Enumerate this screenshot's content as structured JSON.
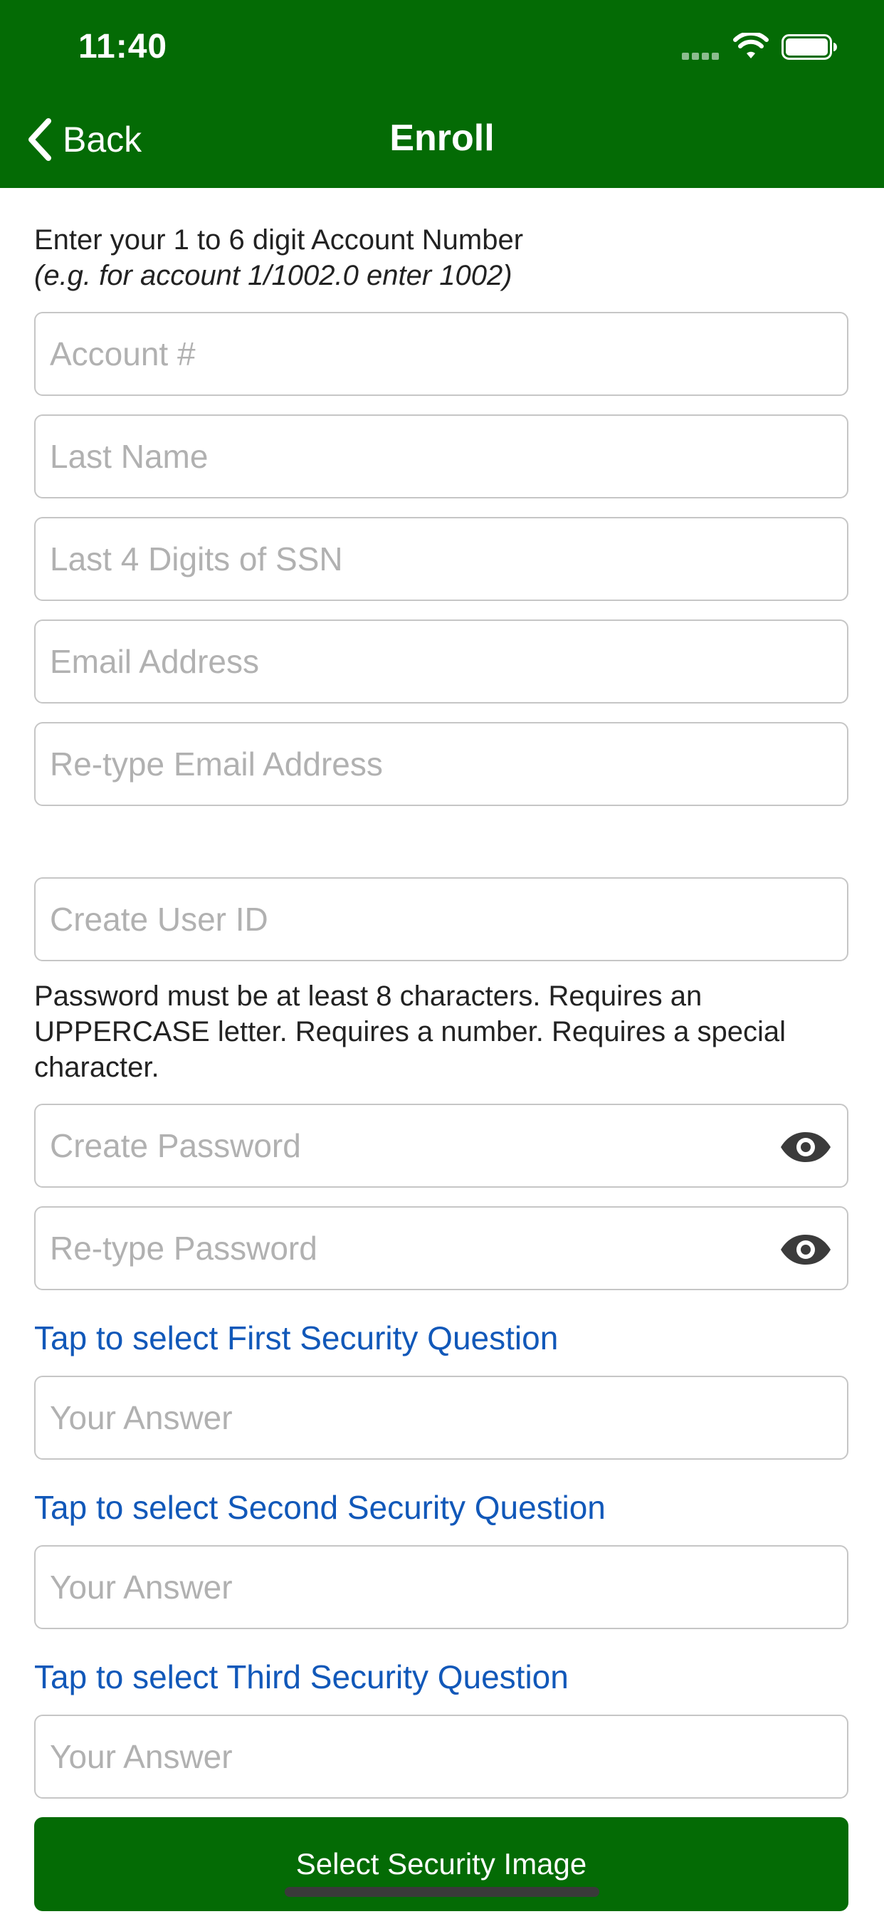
{
  "status_bar": {
    "time": "11:40"
  },
  "nav": {
    "back_label": "Back",
    "title": "Enroll"
  },
  "account_instruction": {
    "line1": "Enter your 1 to 6 digit Account Number",
    "line2": "(e.g. for account 1/1002.0 enter 1002)"
  },
  "fields": {
    "account_number": {
      "placeholder": "Account #",
      "value": ""
    },
    "last_name": {
      "placeholder": "Last Name",
      "value": ""
    },
    "ssn_last4": {
      "placeholder": "Last 4 Digits of SSN",
      "value": ""
    },
    "email": {
      "placeholder": "Email Address",
      "value": ""
    },
    "email_confirm": {
      "placeholder": "Re-type Email Address",
      "value": ""
    },
    "user_id": {
      "placeholder": "Create User ID",
      "value": ""
    },
    "password": {
      "placeholder": "Create Password",
      "value": ""
    },
    "password_confirm": {
      "placeholder": "Re-type Password",
      "value": ""
    },
    "answer1": {
      "placeholder": "Your Answer",
      "value": ""
    },
    "answer2": {
      "placeholder": "Your Answer",
      "value": ""
    },
    "answer3": {
      "placeholder": "Your Answer",
      "value": ""
    }
  },
  "password_rules": "Password must be at least 8 characters. Requires an UPPERCASE letter. Requires a number. Requires a special character.",
  "security_questions": {
    "first_label": "Tap to select First Security Question",
    "second_label": "Tap to select Second Security Question",
    "third_label": "Tap to select Third Security Question"
  },
  "select_image_button": "Select Security Image",
  "colors": {
    "header_green": "#046b05",
    "link_blue": "#1158b9",
    "placeholder_gray": "#b1b1b1",
    "border_gray": "#c6c6c6"
  },
  "icons": {
    "back": "chevron-left-icon",
    "wifi": "wifi-icon",
    "battery": "battery-icon",
    "show_password": "eye-icon"
  }
}
